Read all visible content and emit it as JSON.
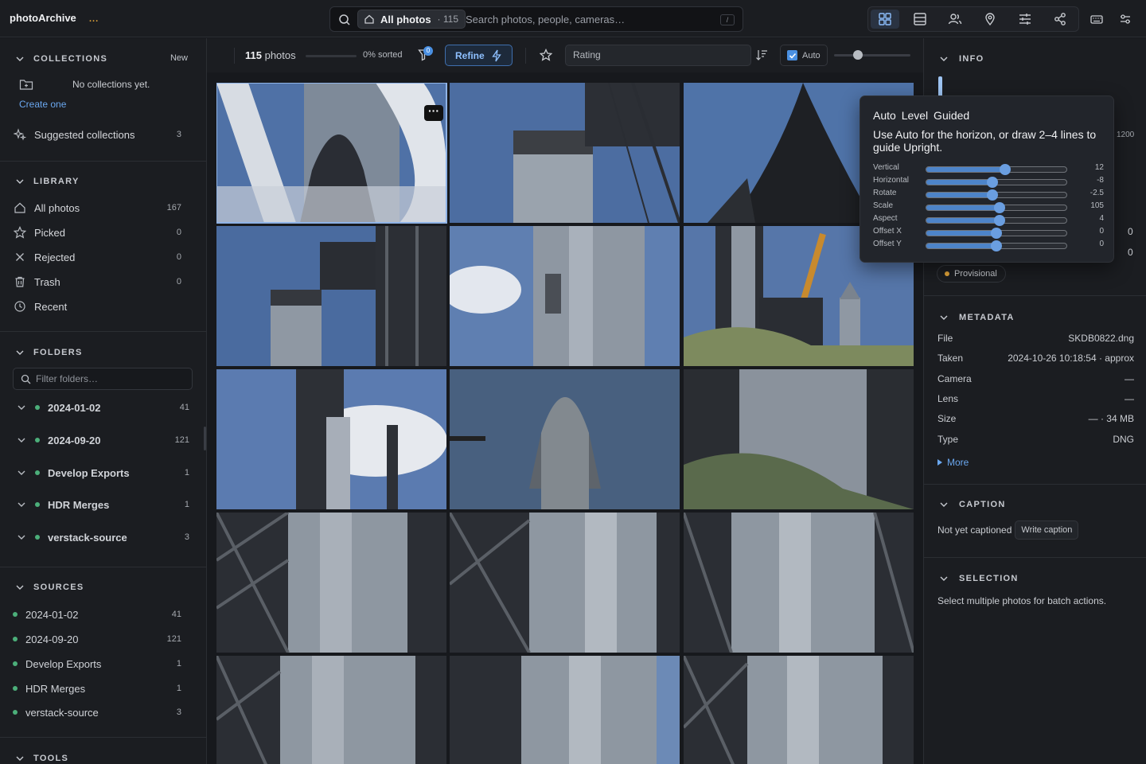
{
  "app": {
    "name": "photoArchive",
    "loading_dots": "..."
  },
  "search": {
    "scope_label": "All photos",
    "scope_count": "· 115",
    "placeholder": "Search photos, people, cameras…",
    "shortcut": "/"
  },
  "view_buttons": [
    "grid-view-icon",
    "table-view-icon",
    "people-icon",
    "map-pin-icon",
    "adjustments-icon",
    "share-icon"
  ],
  "top_right_buttons": [
    "keyboard-icon",
    "settings-sliders-icon"
  ],
  "sidebar": {
    "collections": {
      "title": "COLLECTIONS",
      "new_label": "New",
      "empty_text": "No collections yet.",
      "create_label": "Create one",
      "suggested_label": "Suggested collections",
      "suggested_count": "3"
    },
    "library": {
      "title": "LIBRARY",
      "items": [
        {
          "label": "All photos",
          "count": "167",
          "icon": "home-icon"
        },
        {
          "label": "Picked",
          "count": "0",
          "icon": "star-icon"
        },
        {
          "label": "Rejected",
          "count": "0",
          "icon": "x-icon"
        },
        {
          "label": "Trash",
          "count": "0",
          "icon": "trash-icon"
        },
        {
          "label": "Recent",
          "count": "",
          "icon": "clock-icon"
        }
      ]
    },
    "folders": {
      "title": "FOLDERS",
      "filter_placeholder": "Filter folders…",
      "items": [
        {
          "label": "2024-01-02",
          "count": "41"
        },
        {
          "label": "2024-09-20",
          "count": "121"
        },
        {
          "label": "Develop Exports",
          "count": "1"
        },
        {
          "label": "HDR Merges",
          "count": "1"
        },
        {
          "label": "verstack-source",
          "count": "3"
        }
      ]
    },
    "sources": {
      "title": "SOURCES",
      "items": [
        {
          "label": "2024-01-02",
          "count": "41"
        },
        {
          "label": "2024-09-20",
          "count": "121"
        },
        {
          "label": "Develop Exports",
          "count": "1"
        },
        {
          "label": "HDR Merges",
          "count": "1"
        },
        {
          "label": "verstack-source",
          "count": "3"
        }
      ]
    },
    "tools": {
      "title": "TOOLS"
    }
  },
  "toolbar": {
    "count_num": "115",
    "count_label": " photos",
    "sorted_pct": "0% sorted",
    "sorted_fraction": 0.0,
    "filter_badge": "0",
    "refine_label": "Refine",
    "rating_label": "Rating",
    "auto_label": "Auto",
    "auto_checked": true,
    "zoom_level": 0.3
  },
  "grid": {
    "tile_count": 15,
    "selected_index": 0
  },
  "right_panel": {
    "info": {
      "title": "INFO",
      "tick_right": "1200",
      "value_a": "0",
      "value_b": "0",
      "status_badge": "Provisional"
    },
    "metadata": {
      "title": "METADATA",
      "rows": [
        {
          "key": "File",
          "value": "SKDB0822.dng"
        },
        {
          "key": "Taken",
          "value": "2024-10-26 10:18:54 · approx"
        },
        {
          "key": "Camera",
          "value": "—"
        },
        {
          "key": "Lens",
          "value": "—"
        },
        {
          "key": "Size",
          "value": "— · 34 MB"
        },
        {
          "key": "Type",
          "value": "DNG"
        }
      ],
      "more_label": "More"
    },
    "caption": {
      "title": "CAPTION",
      "empty_text": "Not yet captioned",
      "write_label": "Write caption"
    },
    "selection": {
      "title": "SELECTION",
      "hint": "Select multiple photos for batch actions."
    }
  },
  "popover": {
    "title": "Auto Level Guided",
    "body": "Use Auto for the horizon, or draw 2–4 lines to guide Upright.",
    "sliders": [
      {
        "label": "Vertical",
        "value": "12",
        "fraction": 0.56
      },
      {
        "label": "Horizontal",
        "value": "-8",
        "fraction": 0.47
      },
      {
        "label": "Rotate",
        "value": "-2.5",
        "fraction": 0.47
      },
      {
        "label": "Scale",
        "value": "105",
        "fraction": 0.52
      },
      {
        "label": "Aspect",
        "value": "4",
        "fraction": 0.52
      },
      {
        "label": "Offset X",
        "value": "0",
        "fraction": 0.5
      },
      {
        "label": "Offset Y",
        "value": "0",
        "fraction": 0.5
      }
    ]
  },
  "colors": {
    "accent": "#4a90e2",
    "folder_dot": "#4caf7a",
    "provisional_dot": "#e3a53a",
    "bg": "#17191d",
    "panel": "#1b1d21"
  }
}
